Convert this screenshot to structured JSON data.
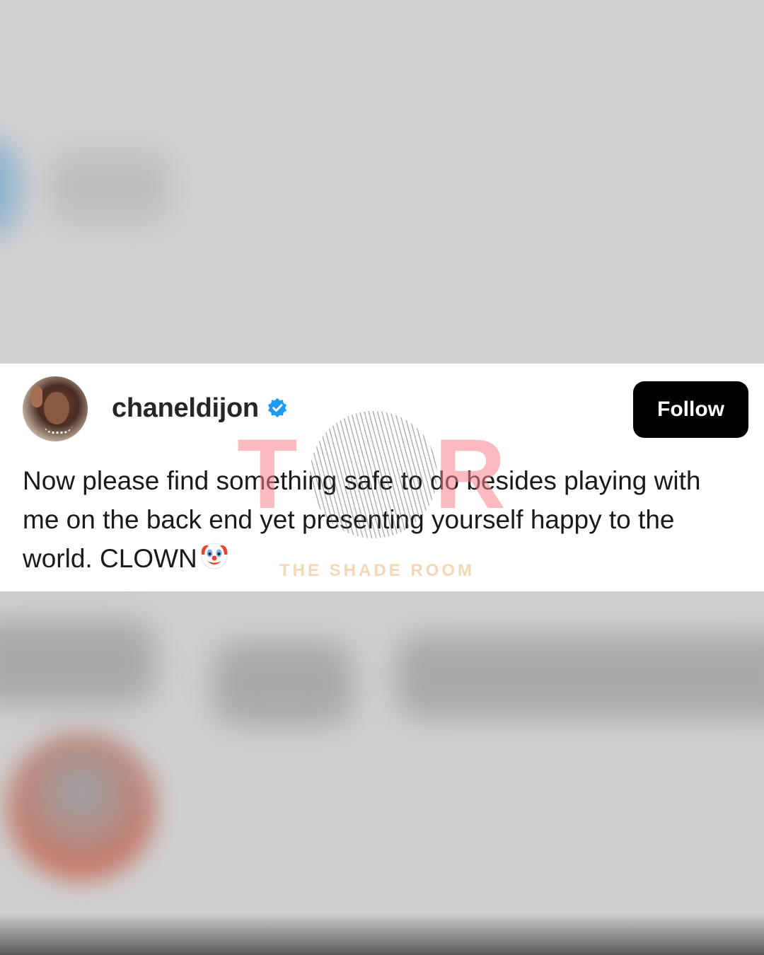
{
  "post": {
    "username": "chaneldijon",
    "verified": true,
    "follow_label": "Follow",
    "text": "Now please find something safe to do besides playing with me on the back end yet presenting yourself happy to the world. CLOWN"
  },
  "watermark": {
    "letters_left": "T",
    "letters_right": "R",
    "subtitle": "THE SHADE ROOM"
  },
  "colors": {
    "verified_blue": "#1D9BF0",
    "follow_bg": "#000000",
    "follow_text": "#FFFFFF",
    "watermark_pink": "#F5828C"
  },
  "icons": {
    "verified": "verified-badge-icon",
    "emoji": "clown-face-icon"
  }
}
